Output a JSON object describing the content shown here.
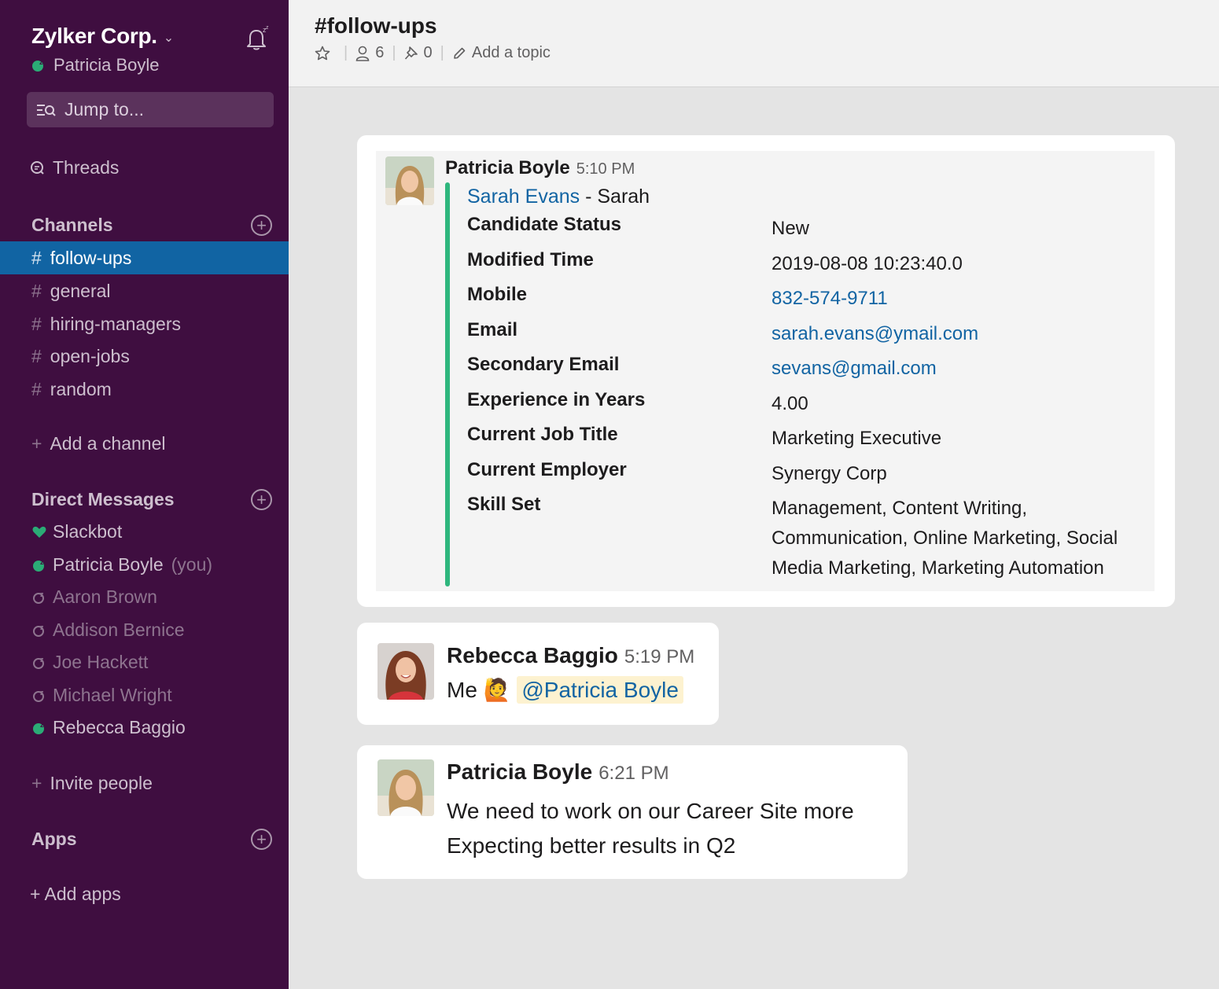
{
  "workspace": {
    "name": "Zylker Corp.",
    "user": "Patricia Boyle"
  },
  "sidebar": {
    "jump_placeholder": "Jump to...",
    "threads_label": "Threads",
    "channels_header": "Channels",
    "channels": [
      "follow-ups",
      "general",
      "hiring-managers",
      "open-jobs",
      "random"
    ],
    "active_channel": "follow-ups",
    "add_channel": "Add a channel",
    "dm_header": "Direct Messages",
    "dms": [
      {
        "name": "Slackbot",
        "status": "bot"
      },
      {
        "name": "Patricia Boyle",
        "status": "online",
        "suffix": "(you)"
      },
      {
        "name": "Aaron Brown",
        "status": "away"
      },
      {
        "name": "Addison Bernice",
        "status": "away"
      },
      {
        "name": "Joe Hackett",
        "status": "away"
      },
      {
        "name": "Michael Wright",
        "status": "away"
      },
      {
        "name": "Rebecca Baggio",
        "status": "online"
      }
    ],
    "invite": "Invite people",
    "apps_header": "Apps",
    "add_apps": "+ Add apps"
  },
  "header": {
    "channel_title": "#follow-ups",
    "members": "6",
    "pins": "0",
    "add_topic": "Add a topic"
  },
  "messages": [
    {
      "author": "Patricia Boyle",
      "time": "5:10 PM",
      "attachment": {
        "link_name": "Sarah Evans",
        "suffix": "- Sarah",
        "fields": [
          {
            "k": "Candidate Status",
            "v": "New"
          },
          {
            "k": "Modified Time",
            "v": "2019-08-08 10:23:40.0"
          },
          {
            "k": "Mobile",
            "v": "832-574-9711"
          },
          {
            "k": "Email",
            "v": "sarah.evans@ymail.com"
          },
          {
            "k": "Secondary Email",
            "v": "sevans@gmail.com"
          },
          {
            "k": "Experience in Years",
            "v": "4.00"
          },
          {
            "k": "Current Job Title",
            "v": "Marketing Executive"
          },
          {
            "k": "Current Employer",
            "v": "Synergy Corp"
          },
          {
            "k": "Skill Set",
            "v": "Management, Content Writing, Communication, Online Marketing, Social Media Marketing, Marketing Automation"
          }
        ]
      }
    },
    {
      "author": "Rebecca Baggio",
      "time": "5:19 PM",
      "text": "Me",
      "emoji": "🙋",
      "mention": "@Patricia Boyle"
    },
    {
      "author": "Patricia Boyle",
      "time": "6:21 PM",
      "line1": "We need to work on our Career Site more",
      "line2": "Expecting better results in Q2"
    }
  ],
  "colors": {
    "sidebar_bg": "#3f0e40",
    "active_channel": "#1164a3",
    "presence_online": "#2bac76",
    "attachment_bar": "#2eb67d",
    "link": "#1264a3"
  }
}
